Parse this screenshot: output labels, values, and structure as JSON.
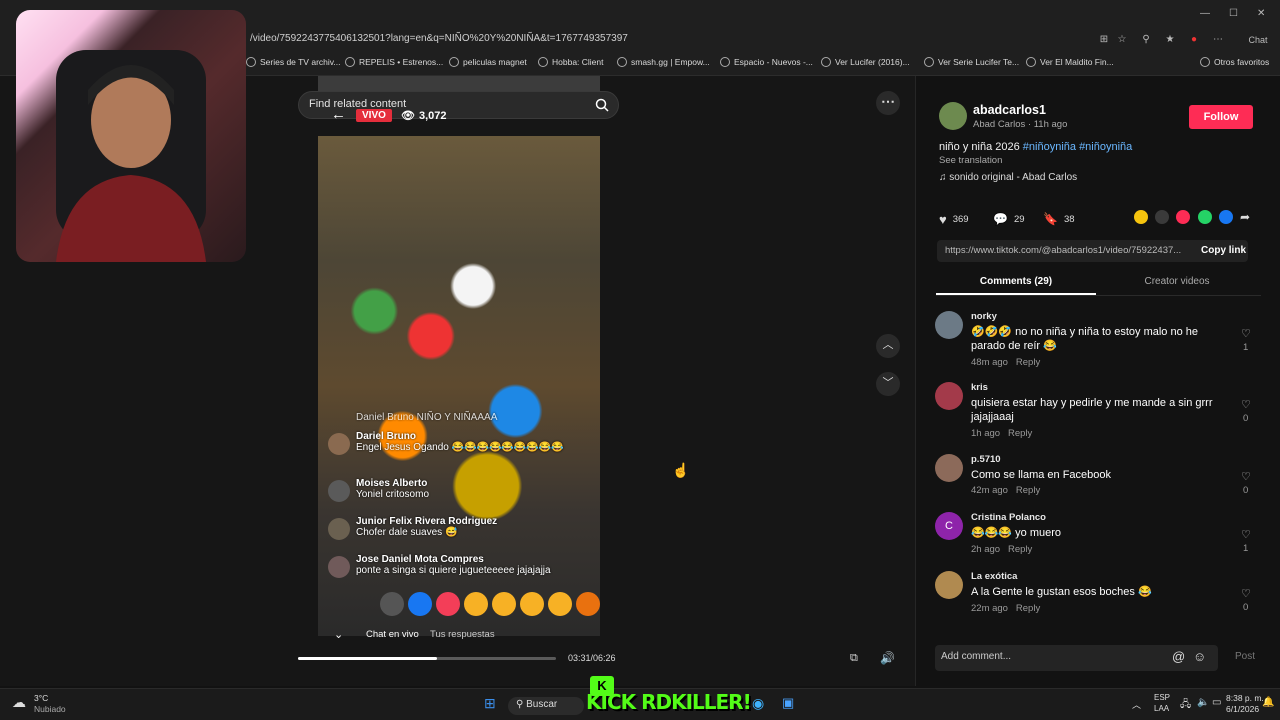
{
  "browser": {
    "url": "/video/7592243775406132501?lang=en&q=NIÑO%20Y%20NIÑA&t=1767749357397",
    "bookmarks": [
      "Series de TV archiv...",
      "REPELIS • Estrenos...",
      "peliculas magnet",
      "Hobba: Client",
      "smash.gg | Empow...",
      "Espacio - Nuevos -...",
      "Ver Lucifer (2016)...",
      "Ver Serie Lucifer Te...",
      "Ver El Maldito Fin...",
      "Otros favoritos"
    ],
    "chat_label": "Chat"
  },
  "search": {
    "placeholder": "Find related content"
  },
  "video": {
    "live_label": "VIVO",
    "viewers": "3,072",
    "overlay_title": "Daniel Bruno NIÑO Y NIÑAAAA",
    "chat": [
      {
        "name": "Dariel Bruno",
        "text": "Engel Jesus Ogando 😂😂😂😂😂😂😂😂😂"
      },
      {
        "name": "Moises Alberto",
        "text": "Yoniel critosomo"
      },
      {
        "name": "Junior Felix Rivera Rodriguez",
        "text": "Chofer dale suaves 😅"
      },
      {
        "name": "Jose Daniel Mota Compres",
        "text": "ponte a singa si quiere jugueteeeee jajajajja"
      }
    ],
    "tab_live_chat": "Chat en vivo",
    "tab_replies": "Tus respuestas",
    "time": "03:31/06:26",
    "progress": 0.54
  },
  "panel": {
    "author": "abadcarlos1",
    "author_sub": "Abad Carlos · 11h ago",
    "follow_label": "Follow",
    "caption": "niño y niña 2026",
    "tags": "#niñoyniña #niñoyniña",
    "see_translation": "See translation",
    "sound": "sonido original - Abad Carlos",
    "likes": "369",
    "comments": "29",
    "saves": "38",
    "link": "https://www.tiktok.com/@abadcarlos1/video/75922437...",
    "copy_link": "Copy link",
    "tab_comments": "Comments (29)",
    "tab_creator": "Creator videos",
    "comment_list": [
      {
        "user": "norky",
        "text": "🤣🤣🤣 no no niña y niña to estoy malo no he parado de reír 😂",
        "time": "48m ago",
        "reply": "Reply",
        "likes": "1"
      },
      {
        "user": "kris",
        "text": "quisiera estar hay y pedirle y me mande a sin grrr jajajjaaaj",
        "time": "1h ago",
        "reply": "Reply",
        "likes": "0"
      },
      {
        "user": "p.5710",
        "text": "Como se llama en Facebook",
        "time": "42m ago",
        "reply": "Reply",
        "likes": "0"
      },
      {
        "user": "Cristina Polanco",
        "text": "😂😂😂 yo muero",
        "time": "2h ago",
        "reply": "Reply",
        "likes": "1"
      },
      {
        "user": "La exótica",
        "text": "A la Gente le gustan esos boches 😂",
        "time": "22m ago",
        "reply": "Reply",
        "likes": "0"
      }
    ],
    "add_comment": "Add comment...",
    "post": "Post"
  },
  "taskbar": {
    "weather_temp": "3°C",
    "weather_desc": "Nubiado",
    "search": "Buscar",
    "lang1": "ESP",
    "lang2": "LAA",
    "clock_time": "8:38 p. m.",
    "clock_date": "6/1/2026",
    "overlay_brand": "KICK RDKILLER!"
  }
}
